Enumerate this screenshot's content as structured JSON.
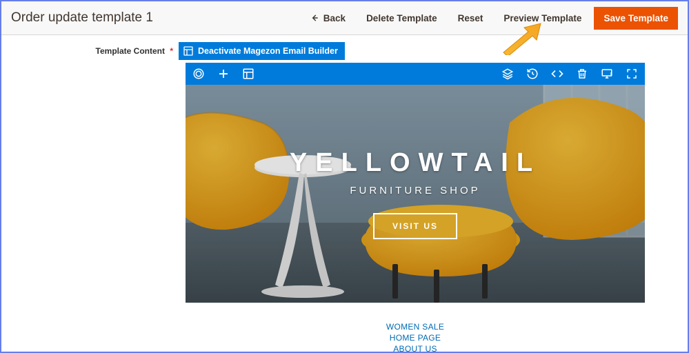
{
  "header": {
    "title": "Order update template 1",
    "back_label": "Back",
    "delete_label": "Delete Template",
    "reset_label": "Reset",
    "preview_label": "Preview Template",
    "save_label": "Save Template"
  },
  "field": {
    "label": "Template Content",
    "deactivate_label": "Deactivate Magezon Email Builder"
  },
  "hero": {
    "title": "YELLOWTAIL",
    "subtitle": "FURNITURE SHOP",
    "cta": "VISIT US"
  },
  "links": {
    "a": "WOMEN SALE",
    "b": "HOME PAGE",
    "c": "ABOUT US"
  },
  "icons": {
    "logo": "logo-circle",
    "add": "plus",
    "layout": "layout",
    "layers": "layers",
    "history": "history",
    "code": "code",
    "trash": "trash",
    "desktop": "desktop",
    "fullscreen": "fullscreen"
  }
}
